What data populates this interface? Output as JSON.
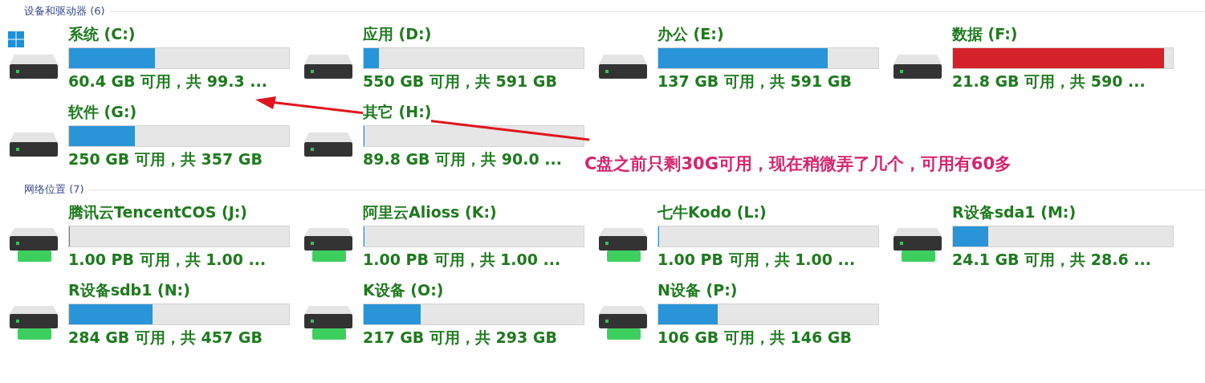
{
  "sections": [
    {
      "title": "设备和驱动器 (6)",
      "drives": [
        {
          "kind": "local",
          "system": true,
          "name": "系统 (C:)",
          "level": 0.39,
          "space": "60.4 GB 可用，共 99.3 ..."
        },
        {
          "kind": "local",
          "system": false,
          "name": "应用 (D:)",
          "level": 0.07,
          "space": "550 GB 可用，共 591 GB"
        },
        {
          "kind": "local",
          "system": false,
          "name": "办公 (E:)",
          "level": 0.77,
          "space": "137 GB 可用，共 591 GB"
        },
        {
          "kind": "local",
          "system": false,
          "name": "数据 (F:)",
          "level": 0.96,
          "space": "21.8 GB 可用，共 590 ..."
        },
        {
          "kind": "local",
          "system": false,
          "name": "软件 (G:)",
          "level": 0.3,
          "space": "250 GB 可用，共 357 GB"
        },
        {
          "kind": "local",
          "system": false,
          "name": "其它 (H:)",
          "level": 0.0,
          "space": "89.8 GB 可用，共 90.0 ..."
        }
      ]
    },
    {
      "title": "网络位置 (7)",
      "drives": [
        {
          "kind": "network",
          "system": false,
          "name": "腾讯云TencentCOS (J:)",
          "level": 0.0,
          "space": "1.00 PB 可用，共 1.00 ..."
        },
        {
          "kind": "network",
          "system": false,
          "name": "阿里云Alioss (K:)",
          "level": 0.0,
          "space": "1.00 PB 可用，共 1.00 ..."
        },
        {
          "kind": "network",
          "system": false,
          "name": "七牛Kodo (L:)",
          "level": 0.0,
          "space": "1.00 PB 可用，共 1.00 ..."
        },
        {
          "kind": "network",
          "system": false,
          "name": "R设备sda1 (M:)",
          "level": 0.16,
          "space": "24.1 GB 可用，共 28.6 ..."
        },
        {
          "kind": "network",
          "system": false,
          "name": "R设备sdb1 (N:)",
          "level": 0.38,
          "space": "284 GB 可用，共 457 GB"
        },
        {
          "kind": "network",
          "system": false,
          "name": "K设备 (O:)",
          "level": 0.26,
          "space": "217 GB 可用，共 293 GB"
        },
        {
          "kind": "network",
          "system": false,
          "name": "N设备 (P:)",
          "level": 0.27,
          "space": "106 GB 可用，共 146 GB"
        }
      ]
    }
  ],
  "annotation": {
    "text": "C盘之前只剩30G可用，现在稍微弄了几个，可用有60多"
  }
}
